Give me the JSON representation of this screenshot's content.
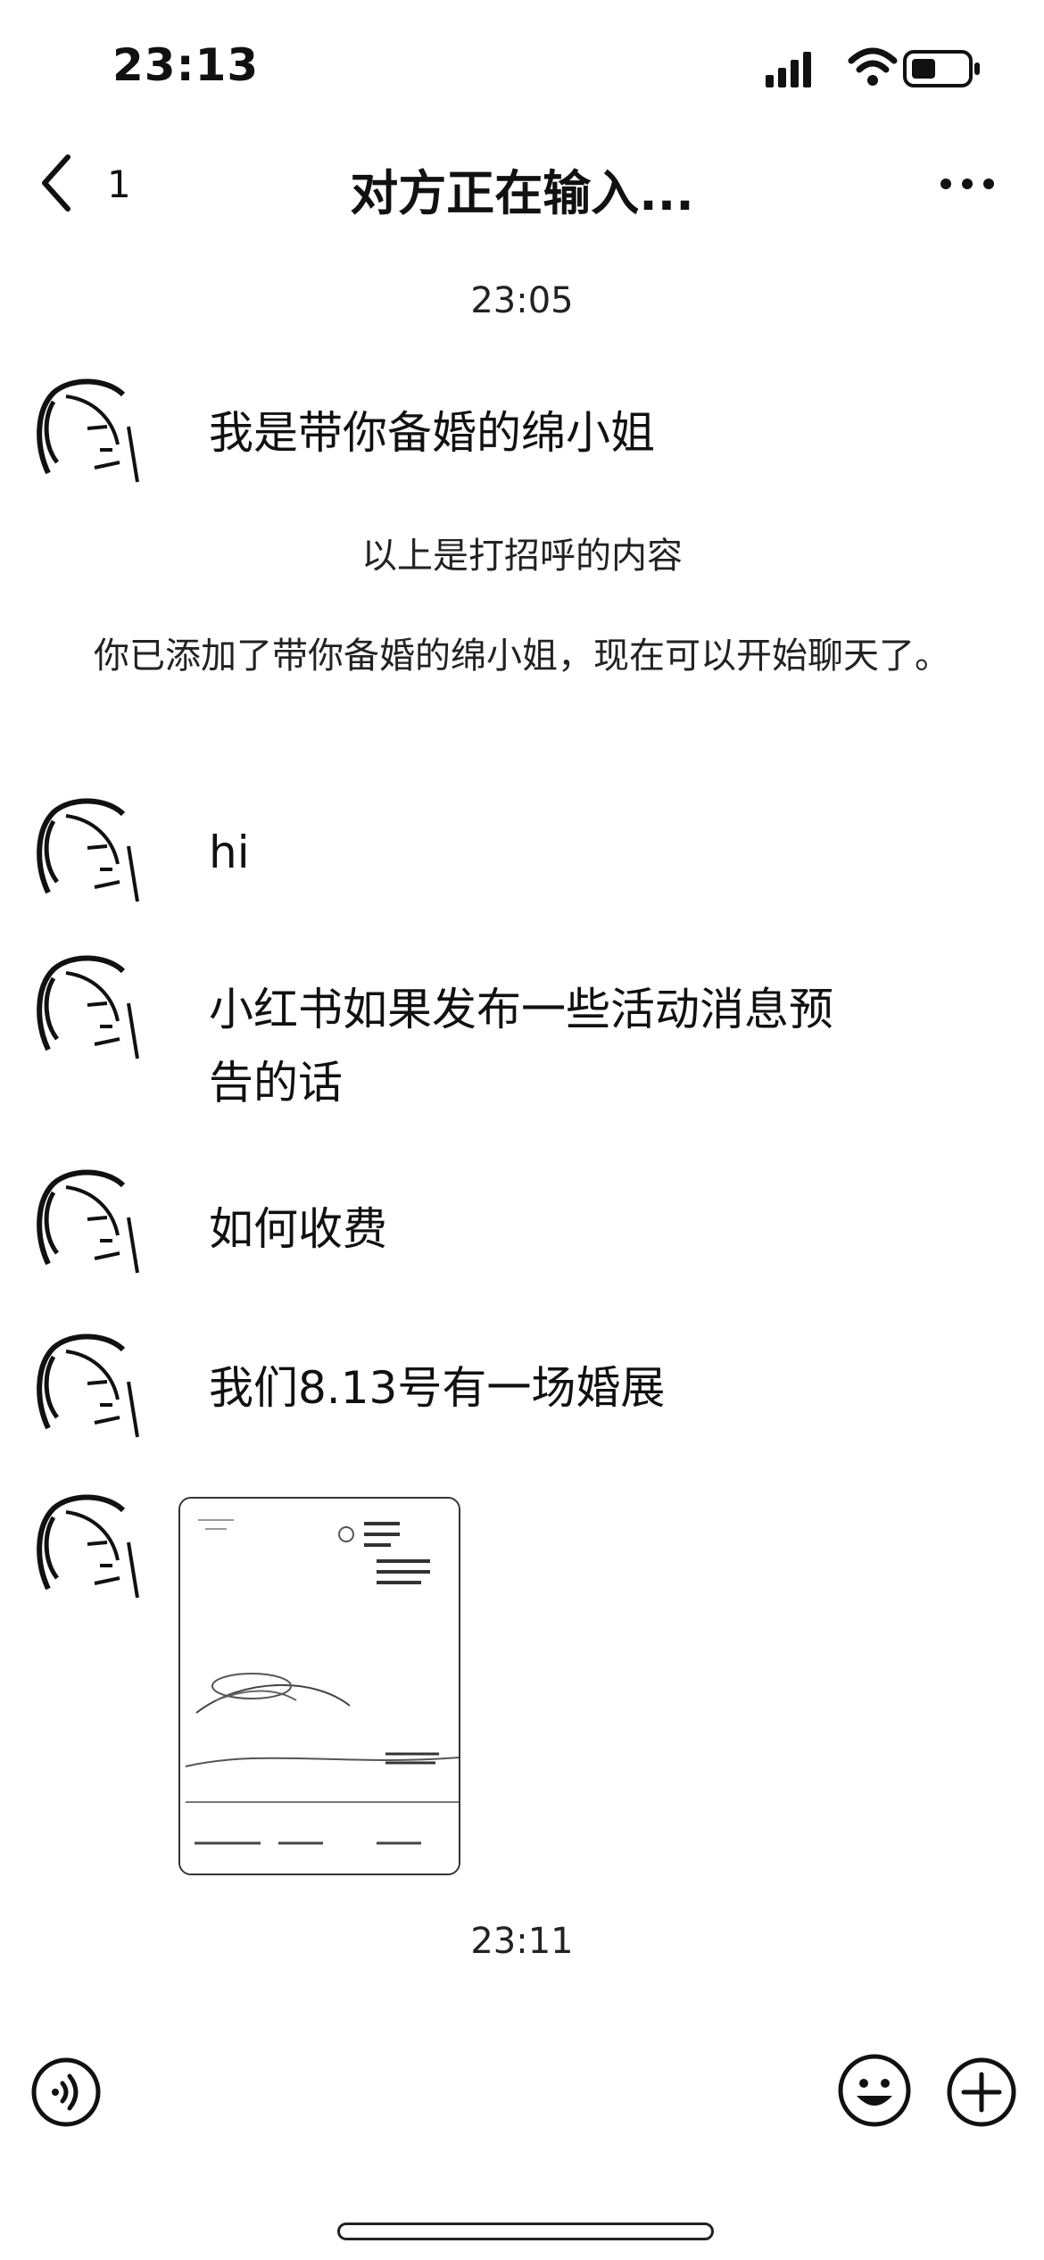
{
  "status": {
    "time": "23:13"
  },
  "nav": {
    "back_count": "1",
    "title": "对方正在输入..."
  },
  "timestamps": {
    "first": "23:05",
    "second": "23:11"
  },
  "system": {
    "greeting_note": "以上是打招呼的内容",
    "added_note": "你已添加了带你备婚的绵小姐，现在可以开始聊天了。"
  },
  "messages": [
    {
      "text": "我是带你备婚的绵小姐"
    },
    {
      "text": "hi"
    },
    {
      "text": "小红书如果发布一些活动消息预告的话"
    },
    {
      "text": "如何收费"
    },
    {
      "text": "我们8.13号有一场婚展"
    }
  ],
  "icons": {
    "back": "chevron-left-icon",
    "more": "more-icon",
    "voice": "voice-icon",
    "emoji": "emoji-icon",
    "plus": "plus-icon"
  }
}
